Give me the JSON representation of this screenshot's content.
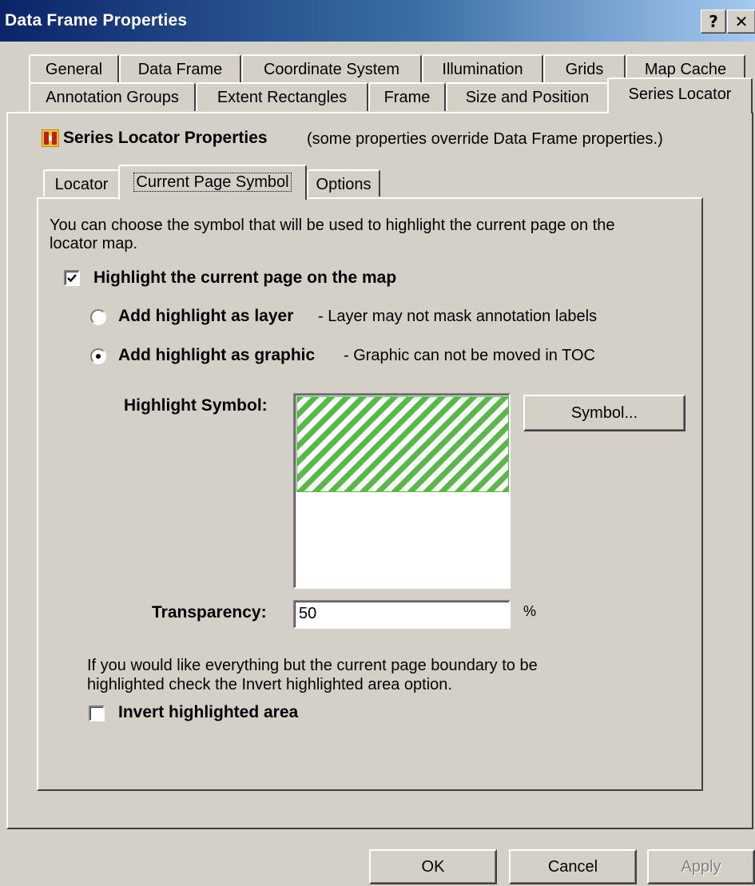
{
  "window": {
    "title": "Data Frame Properties",
    "help_glyph": "?",
    "close_glyph": "✕"
  },
  "tabs": {
    "row1": [
      "General",
      "Data Frame",
      "Coordinate System",
      "Illumination",
      "Grids",
      "Map Cache"
    ],
    "row2": [
      "Annotation Groups",
      "Extent Rectangles",
      "Frame",
      "Size and Position",
      "Series Locator"
    ],
    "selected": "Series Locator"
  },
  "series_locator": {
    "heading": "Series Locator Properties",
    "note": "(some properties override Data Frame properties.)",
    "icon": "series-locator-icon"
  },
  "subtabs": {
    "items": [
      "Locator",
      "Current Page Symbol",
      "Options"
    ],
    "selected": "Current Page Symbol"
  },
  "current_page_symbol": {
    "intro_line1": "You can choose the symbol that will be used to highlight the current page on the",
    "intro_line2": "locator map.",
    "highlight_label": "Highlight the current page on the map",
    "highlight_checked": true,
    "layer_option": {
      "label": "Add highlight as layer",
      "desc": "- Layer may not mask annotation labels",
      "selected": false
    },
    "graphic_option": {
      "label": "Add highlight as graphic",
      "desc": "- Graphic can not be moved in TOC",
      "selected": true
    },
    "symbol_label": "Highlight Symbol:",
    "symbol_button": "Symbol...",
    "symbol_colors": {
      "hatch": "#59b948",
      "background": "#ffffff"
    },
    "transparency_label": "Transparency:",
    "transparency_value": "50",
    "transparency_unit": "%",
    "invert_note_line1": "If you would like everything but the current page boundary to be",
    "invert_note_line2": "highlighted check the Invert highlighted area option.",
    "invert_label": "Invert highlighted area",
    "invert_checked": false
  },
  "buttons": {
    "ok": "OK",
    "cancel": "Cancel",
    "apply": "Apply"
  }
}
